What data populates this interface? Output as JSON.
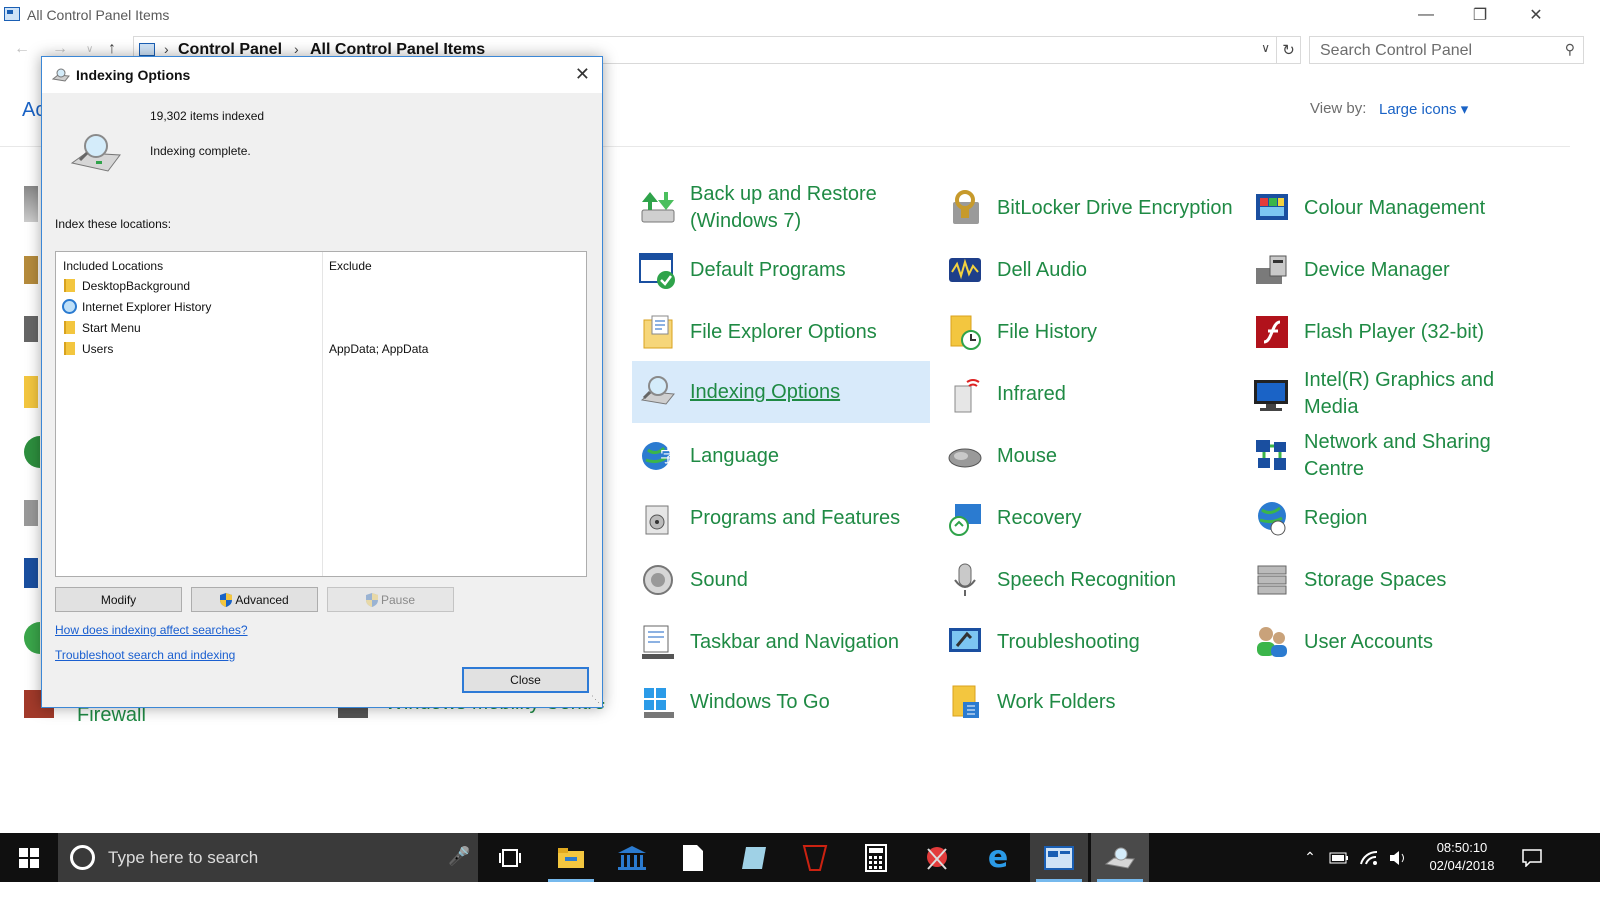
{
  "window": {
    "title": "All Control Panel Items"
  },
  "address": {
    "crumbs": [
      "Control Panel",
      "All Control Panel Items"
    ]
  },
  "search": {
    "placeholder": "Search Control Panel"
  },
  "viewby": {
    "label": "View by:",
    "value": "Large icons ▾"
  },
  "header": {
    "partial_title": "Ac"
  },
  "items": [
    {
      "label": "Back up and Restore (Windows 7)",
      "icon": "backup-restore-icon"
    },
    {
      "label": "BitLocker Drive Encryption",
      "icon": "bitlocker-icon"
    },
    {
      "label": "Colour Management",
      "icon": "colour-management-icon"
    },
    {
      "label": "Default Programs",
      "icon": "default-programs-icon"
    },
    {
      "label": "Dell Audio",
      "icon": "dell-audio-icon"
    },
    {
      "label": "Device Manager",
      "icon": "device-manager-icon"
    },
    {
      "label": "File Explorer Options",
      "icon": "file-explorer-options-icon"
    },
    {
      "label": "File History",
      "icon": "file-history-icon"
    },
    {
      "label": "Flash Player (32-bit)",
      "icon": "flash-player-icon"
    },
    {
      "label": "Indexing Options",
      "icon": "indexing-options-icon"
    },
    {
      "label": "Infrared",
      "icon": "infrared-icon"
    },
    {
      "label": "Intel(R) Graphics and Media",
      "icon": "intel-graphics-icon"
    },
    {
      "label": "Language",
      "icon": "language-icon"
    },
    {
      "label": "Mouse",
      "icon": "mouse-icon"
    },
    {
      "label": "Network and Sharing Centre",
      "icon": "network-sharing-icon"
    },
    {
      "label": "Programs and Features",
      "icon": "programs-features-icon"
    },
    {
      "label": "Recovery",
      "icon": "recovery-icon"
    },
    {
      "label": "Region",
      "icon": "region-icon"
    },
    {
      "label": "Sound",
      "icon": "sound-icon"
    },
    {
      "label": "Speech Recognition",
      "icon": "speech-recognition-icon"
    },
    {
      "label": "Storage Spaces",
      "icon": "storage-spaces-icon"
    },
    {
      "label": "Taskbar and Navigation",
      "icon": "taskbar-navigation-icon"
    },
    {
      "label": "Troubleshooting",
      "icon": "troubleshooting-icon"
    },
    {
      "label": "User Accounts",
      "icon": "user-accounts-icon"
    },
    {
      "label": "Windows To Go",
      "icon": "windows-to-go-icon"
    },
    {
      "label": "Work Folders",
      "icon": "work-folders-icon"
    }
  ],
  "partial_items": {
    "firewall": "Firewall",
    "mobility": "Windows Mobility Centre"
  },
  "dialog": {
    "title": "Indexing Options",
    "items_indexed": "19,302 items indexed",
    "status": "Indexing complete.",
    "locations_label": "Index these locations:",
    "col_included": "Included Locations",
    "col_exclude": "Exclude",
    "locations": [
      {
        "name": "DesktopBackground",
        "exclude": "",
        "icon": "folder-icon"
      },
      {
        "name": "Internet Explorer History",
        "exclude": "",
        "icon": "ie-icon"
      },
      {
        "name": "Start Menu",
        "exclude": "",
        "icon": "folder-icon"
      },
      {
        "name": "Users",
        "exclude": "AppData; AppData",
        "icon": "folder-icon"
      }
    ],
    "buttons": {
      "modify": "Modify",
      "advanced": "Advanced",
      "pause": "Pause",
      "close": "Close"
    },
    "links": {
      "how": "How does indexing affect searches?",
      "troubleshoot": "Troubleshoot search and indexing"
    }
  },
  "taskbar": {
    "search_placeholder": "Type here to search",
    "time": "08:50:10",
    "date": "02/04/2018"
  }
}
